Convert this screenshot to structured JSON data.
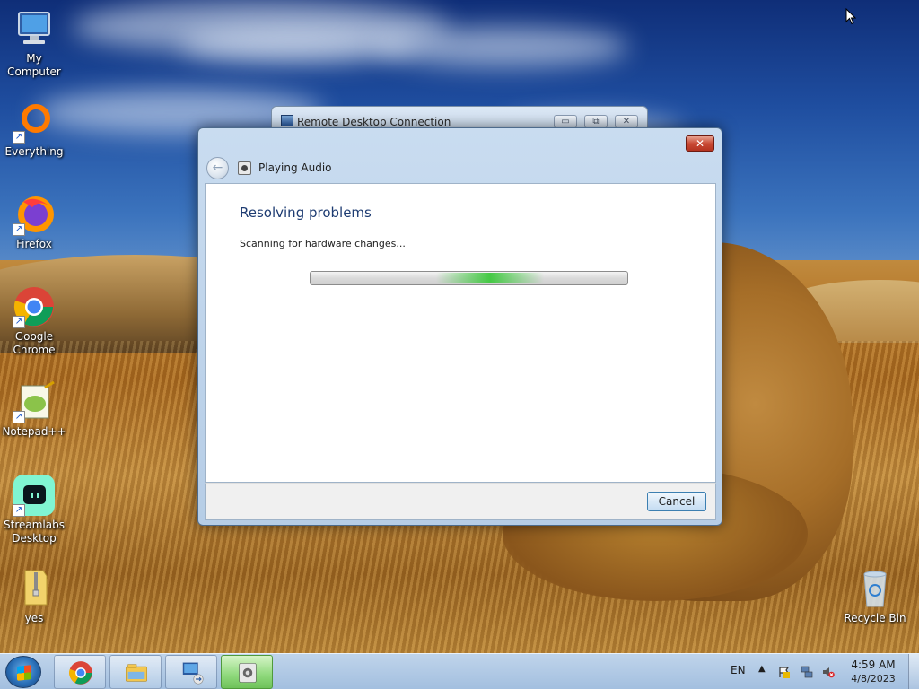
{
  "desktop": {
    "icons": [
      {
        "label": "My Computer",
        "icon": "computer-icon"
      },
      {
        "label": "Everything",
        "icon": "everything-icon"
      },
      {
        "label": "Firefox",
        "icon": "firefox-icon"
      },
      {
        "label": "Google Chrome",
        "icon": "chrome-icon"
      },
      {
        "label": "Notepad++",
        "icon": "notepadpp-icon"
      },
      {
        "label": "Streamlabs Desktop",
        "icon": "streamlabs-icon"
      },
      {
        "label": "yes",
        "icon": "zip-folder-icon"
      },
      {
        "label": "Recycle Bin",
        "icon": "recycle-bin-icon"
      }
    ]
  },
  "background_window": {
    "title": "Remote Desktop Connection",
    "buttons": {
      "minimize": "▭",
      "restore": "⧉",
      "close": "✕"
    }
  },
  "dialog": {
    "close_glyph": "✕",
    "back_glyph": "←",
    "nav_title": "Playing Audio",
    "heading": "Resolving problems",
    "status": "Scanning for hardware changes...",
    "cancel_label": "Cancel"
  },
  "taskbar": {
    "apps": [
      {
        "name": "Google Chrome",
        "icon": "chrome-icon"
      },
      {
        "name": "Windows Explorer",
        "icon": "explorer-icon"
      },
      {
        "name": "Remote Desktop Connection",
        "icon": "remote-desktop-icon"
      },
      {
        "name": "Playing Audio troubleshooter",
        "icon": "troubleshooter-icon",
        "active": true
      }
    ],
    "language": "EN",
    "time": "4:59 AM",
    "date": "4/8/2023"
  },
  "colors": {
    "accent_blue": "#1e3c72",
    "progress_green": "#3cc83c",
    "close_red": "#c94a35"
  }
}
